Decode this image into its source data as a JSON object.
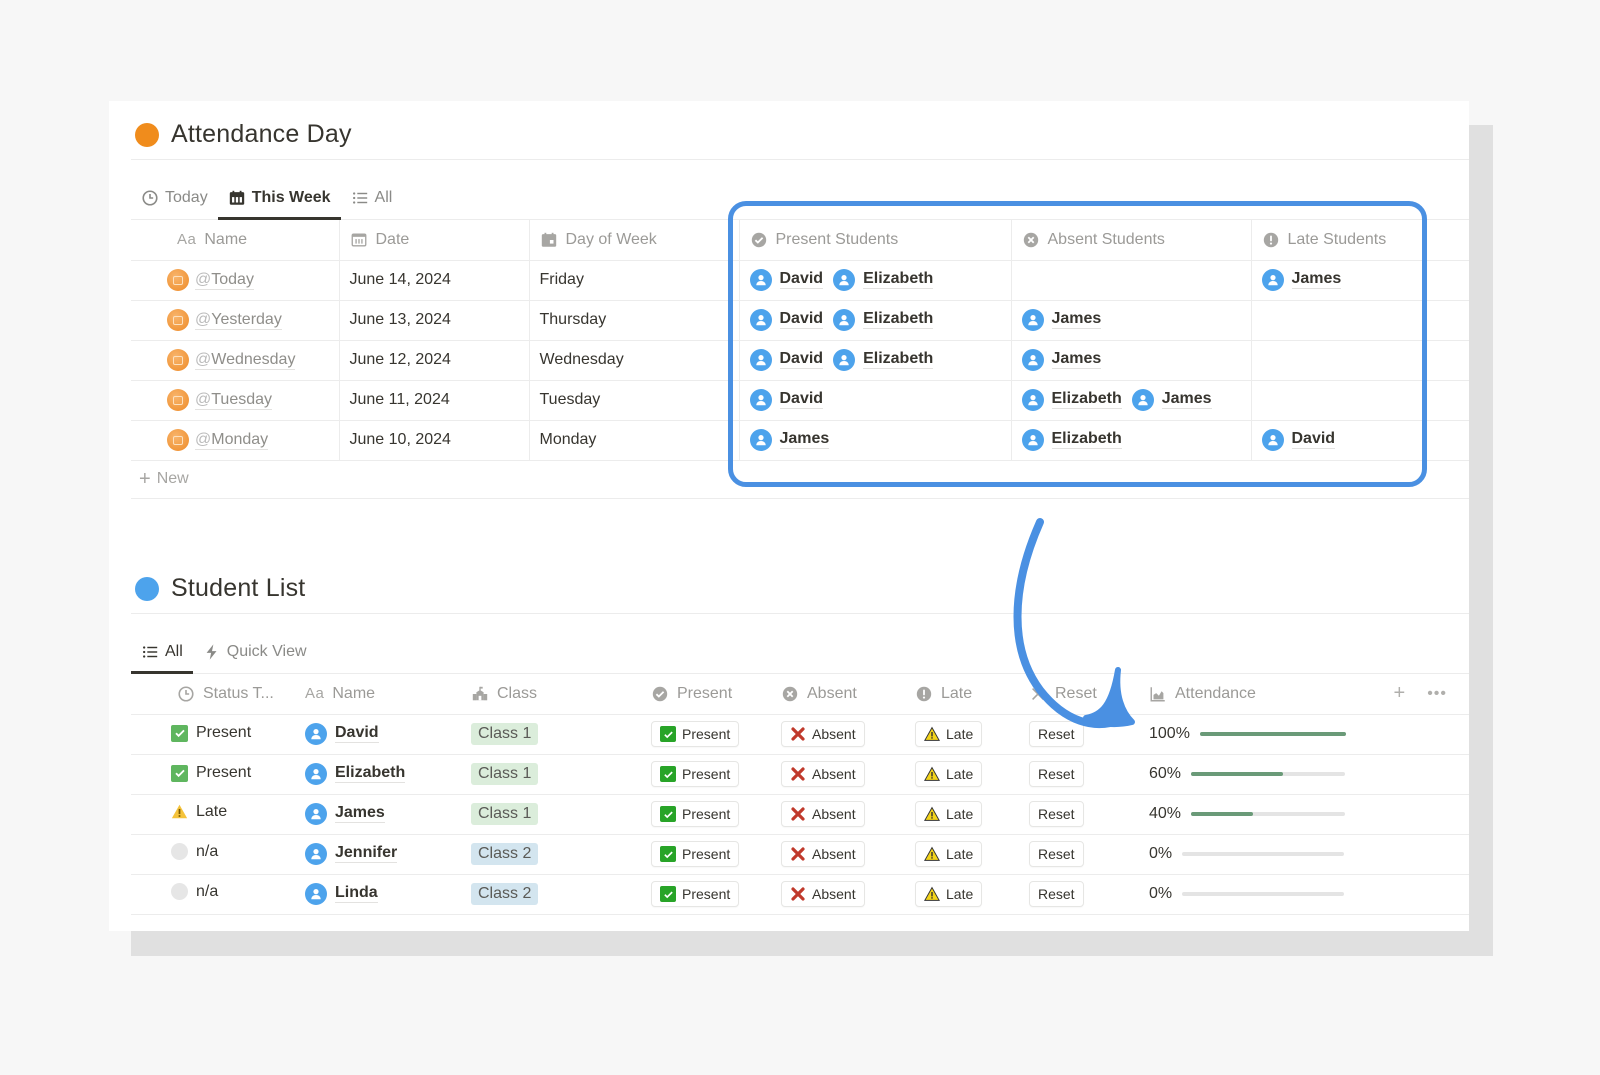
{
  "attendance_day": {
    "title": "Attendance Day",
    "dot_color": "#f08c1c",
    "tabs": [
      {
        "label": "Today",
        "icon": "clock-icon",
        "active": false
      },
      {
        "label": "This Week",
        "icon": "calendar-icon",
        "active": true
      },
      {
        "label": "All",
        "icon": "list-icon",
        "active": false
      }
    ],
    "columns": {
      "name": "Name",
      "name_prefix": "Aa",
      "date": "Date",
      "day_of_week": "Day of Week",
      "present": "Present Students",
      "absent": "Absent Students",
      "late": "Late Students"
    },
    "rows": [
      {
        "name": "Today",
        "date": "June 14, 2024",
        "day": "Friday",
        "present": [
          "David",
          "Elizabeth"
        ],
        "absent": [],
        "late": [
          "James"
        ]
      },
      {
        "name": "Yesterday",
        "date": "June 13, 2024",
        "day": "Thursday",
        "present": [
          "David",
          "Elizabeth"
        ],
        "absent": [
          "James"
        ],
        "late": []
      },
      {
        "name": "Wednesday",
        "date": "June 12, 2024",
        "day": "Wednesday",
        "present": [
          "David",
          "Elizabeth"
        ],
        "absent": [
          "James"
        ],
        "late": []
      },
      {
        "name": "Tuesday",
        "date": "June 11, 2024",
        "day": "Tuesday",
        "present": [
          "David"
        ],
        "absent": [
          "Elizabeth",
          "James"
        ],
        "late": []
      },
      {
        "name": "Monday",
        "date": "June 10, 2024",
        "day": "Monday",
        "present": [
          "James"
        ],
        "absent": [
          "Elizabeth"
        ],
        "late": [
          "David"
        ]
      }
    ],
    "new_label": "New",
    "mention_prefix": "@"
  },
  "student_list": {
    "title": "Student List",
    "dot_color": "#4da3ec",
    "tabs": [
      {
        "label": "All",
        "icon": "list-icon",
        "active": true
      },
      {
        "label": "Quick View",
        "icon": "lightning-icon",
        "active": false
      }
    ],
    "columns": {
      "status": "Status T...",
      "name": "Name",
      "name_prefix": "Aa",
      "class": "Class",
      "present": "Present",
      "absent": "Absent",
      "late": "Late",
      "reset": "Reset",
      "attendance": "Attendance"
    },
    "button_labels": {
      "present": "Present",
      "absent": "Absent",
      "late": "Late",
      "reset": "Reset"
    },
    "rows": [
      {
        "status": "Present",
        "status_kind": "present",
        "name": "David",
        "class": "Class 1",
        "attendance_label": "100%",
        "attendance": 1.0
      },
      {
        "status": "Present",
        "status_kind": "present",
        "name": "Elizabeth",
        "class": "Class 1",
        "attendance_label": "60%",
        "attendance": 0.6
      },
      {
        "status": "Late",
        "status_kind": "late",
        "name": "James",
        "class": "Class 1",
        "attendance_label": "40%",
        "attendance": 0.4
      },
      {
        "status": "n/a",
        "status_kind": "none",
        "name": "Jennifer",
        "class": "Class 2",
        "attendance_label": "0%",
        "attendance": 0.0
      },
      {
        "status": "n/a",
        "status_kind": "none",
        "name": "Linda",
        "class": "Class 2",
        "attendance_label": "0%",
        "attendance": 0.0
      }
    ],
    "class_colors": {
      "Class 1": "#dbeddb",
      "Class 2": "#d3e5ef"
    },
    "progress_color": "#6a9a78"
  },
  "annotation": {
    "highlight_color": "#4a90e2"
  }
}
